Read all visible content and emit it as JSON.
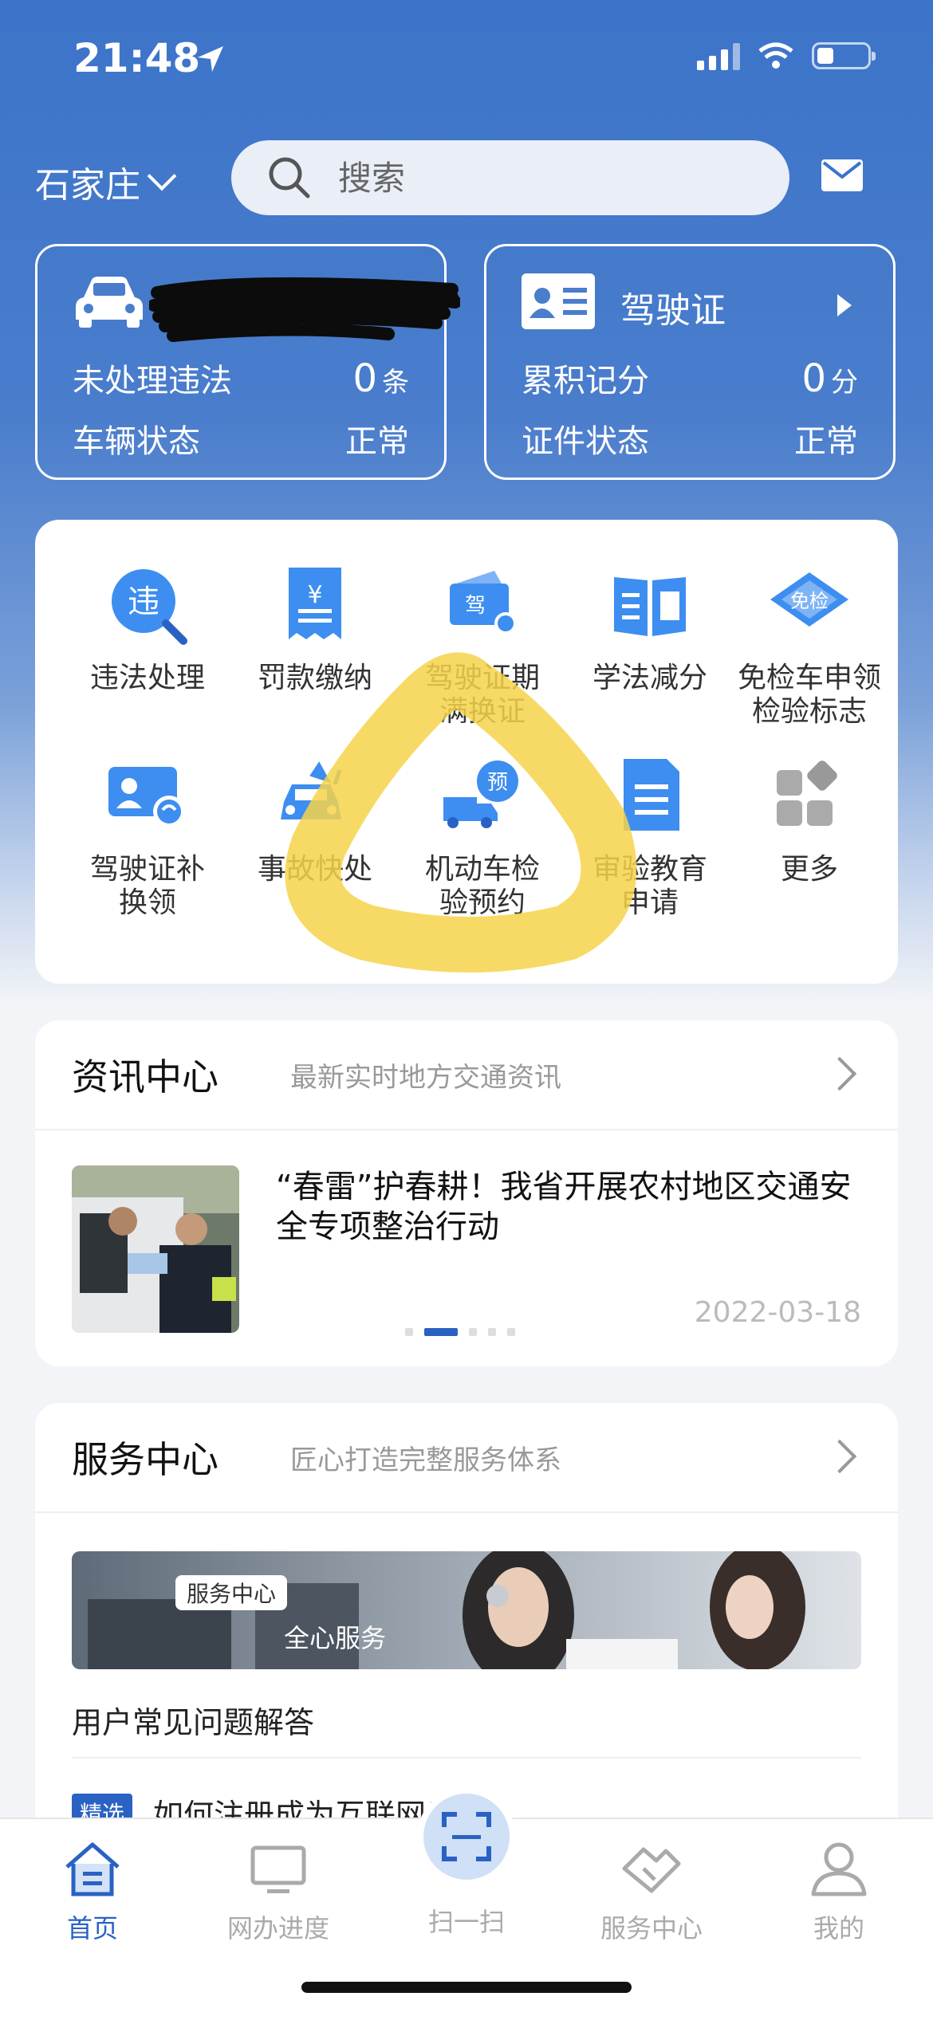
{
  "status_bar": {
    "time": "21:48"
  },
  "header": {
    "city": "石家庄",
    "search_placeholder": "搜索"
  },
  "cards": {
    "vehicle": {
      "rows": [
        {
          "label": "未处理违法",
          "value": "0",
          "unit": "条"
        },
        {
          "label": "车辆状态",
          "value": "正常",
          "unit": ""
        }
      ]
    },
    "license": {
      "title": "驾驶证",
      "rows": [
        {
          "label": "累积记分",
          "value": "0",
          "unit": "分"
        },
        {
          "label": "证件状态",
          "value": "正常",
          "unit": ""
        }
      ]
    }
  },
  "services": [
    {
      "icon": "violation-icon",
      "line1": "违法处理",
      "line2": ""
    },
    {
      "icon": "fine-payment-icon",
      "line1": "罚款缴纳",
      "line2": ""
    },
    {
      "icon": "license-renewal-icon",
      "line1": "驾驶证期",
      "line2": "满换证"
    },
    {
      "icon": "study-reduce-icon",
      "line1": "学法减分",
      "line2": ""
    },
    {
      "icon": "exempt-inspection-icon",
      "line1": "免检车申领",
      "line2": "检验标志"
    },
    {
      "icon": "license-replace-icon",
      "line1": "驾驶证补",
      "line2": "换领"
    },
    {
      "icon": "accident-icon",
      "line1": "事故快处",
      "line2": ""
    },
    {
      "icon": "inspection-booking-icon",
      "line1": "机动车检",
      "line2": "验预约"
    },
    {
      "icon": "education-icon",
      "line1": "审验教育",
      "line2": "申请"
    },
    {
      "icon": "more-icon",
      "line1": "更多",
      "line2": ""
    }
  ],
  "service_badges": {
    "violation": "违",
    "license": "驾",
    "booking": "预",
    "exempt": "免检"
  },
  "news": {
    "title": "资讯中心",
    "subtitle": "最新实时地方交通资讯",
    "headline": "“春雷”护春耕！我省开展农村地区交通安全专项整治行动",
    "date": "2022-03-18"
  },
  "service_center": {
    "title": "服务中心",
    "subtitle": "匠心打造完整服务体系",
    "banner_tag": "服务中心",
    "banner_text": "全心服务",
    "faq_title": "用户常见问题解答",
    "faq_badge": "精选",
    "faq_question": "如何注册成为互联网用户?"
  },
  "tabbar": [
    {
      "label": "首页",
      "icon": "home-icon",
      "active": true
    },
    {
      "label": "网办进度",
      "icon": "monitor-icon",
      "active": false
    },
    {
      "label": "扫一扫",
      "icon": "scan-icon",
      "active": false
    },
    {
      "label": "服务中心",
      "icon": "handshake-icon",
      "active": false
    },
    {
      "label": "我的",
      "icon": "user-icon",
      "active": false
    }
  ],
  "colors": {
    "primary": "#3c74c9",
    "accent_blue": "#2a62c4",
    "highlight": "#f6d34a"
  }
}
